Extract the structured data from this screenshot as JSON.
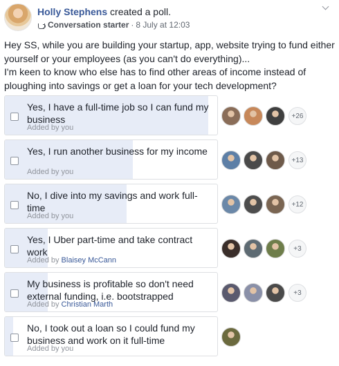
{
  "post": {
    "author": "Holly Stephens",
    "action": "created a poll.",
    "badge_label": "Conversation starter",
    "separator": "·",
    "timestamp": "8 July at 12:03",
    "body_line1": "Hey SS, while you are building your startup, app, website trying to fund either yourself or your employees (as you can't do everything)...",
    "body_line2": "I'm keen to know who else has to find other areas of income instead of ploughing into savings or get a loan for your tech development?"
  },
  "poll": {
    "options": [
      {
        "text": "Yes, I have a full-time job so I can fund my business",
        "added_prefix": "Added by",
        "added_name": "you",
        "added_name_is_link": false,
        "vote_share": 0.95,
        "more": "+26",
        "voters": 3
      },
      {
        "text": "Yes, I run another business for my income",
        "added_prefix": "Added by",
        "added_name": "you",
        "added_name_is_link": false,
        "vote_share": 0.6,
        "more": "+13",
        "voters": 3
      },
      {
        "text": "No, I dive into my savings and work full-time",
        "added_prefix": "Added by",
        "added_name": "you",
        "added_name_is_link": false,
        "vote_share": 0.57,
        "more": "+12",
        "voters": 3
      },
      {
        "text": "Yes, I Uber part-time and take contract work",
        "added_prefix": "Added by",
        "added_name": "Blaisey McCann",
        "added_name_is_link": true,
        "vote_share": 0.2,
        "more": "+3",
        "voters": 3
      },
      {
        "text": "My business is profitable so don't need external funding, i.e. bootstrapped",
        "added_prefix": "Added by",
        "added_name": "Christian Marth",
        "added_name_is_link": true,
        "vote_share": 0.2,
        "more": "+3",
        "voters": 3
      },
      {
        "text": "No, I took out a loan so I could fund my business and work on it full-time",
        "added_prefix": "Added by",
        "added_name": "you",
        "added_name_is_link": false,
        "vote_share": 0.04,
        "more": "",
        "voters": 1
      }
    ]
  },
  "colors": {
    "link": "#385898",
    "bar_fill": "#e7ecf7",
    "border": "#dddfe2",
    "meta": "#90949c"
  },
  "icons": {
    "badge": "coffee-icon",
    "menu": "chevron-down-icon"
  }
}
